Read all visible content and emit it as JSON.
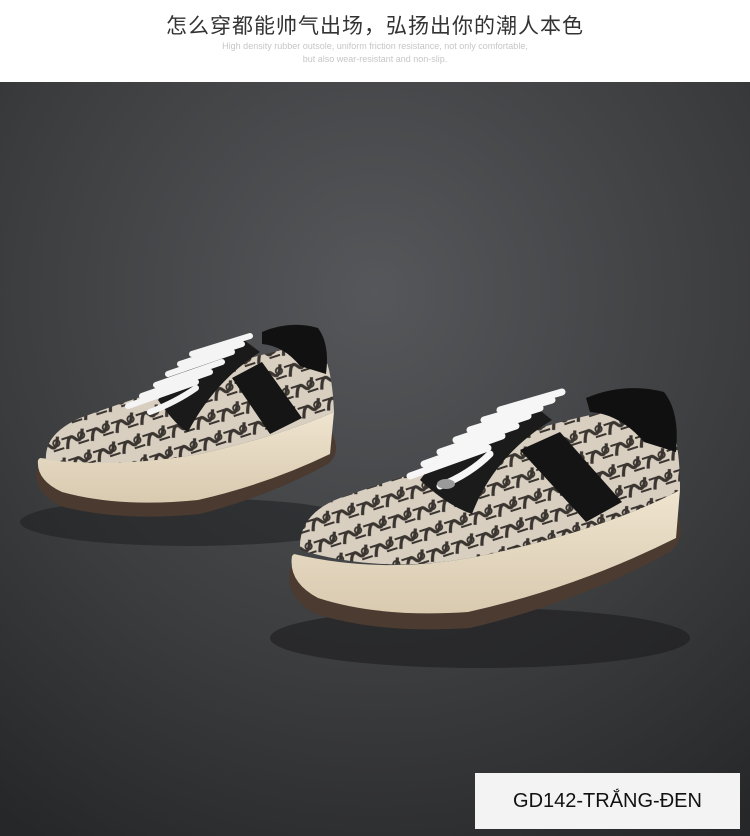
{
  "header": {
    "headline": "怎么穿都能帅气出场，弘扬出你的潮人本色",
    "subline_1": "High density rubber outsole, uniform friction resistance, not only comfortable,",
    "subline_2": "but also wear-resistant and non-slip."
  },
  "product": {
    "sku_label": "GD142-TRẮNG-ĐEN"
  },
  "photo": {
    "subject": "sneakers-pair-icon",
    "background_color": "#3b3c3e",
    "upper_pattern_colors": [
      "#d8cfc1",
      "#3a3530"
    ],
    "sole_color": "#e7dbc4",
    "lace_color": "#f4f4f4",
    "panel_color": "#151515"
  }
}
